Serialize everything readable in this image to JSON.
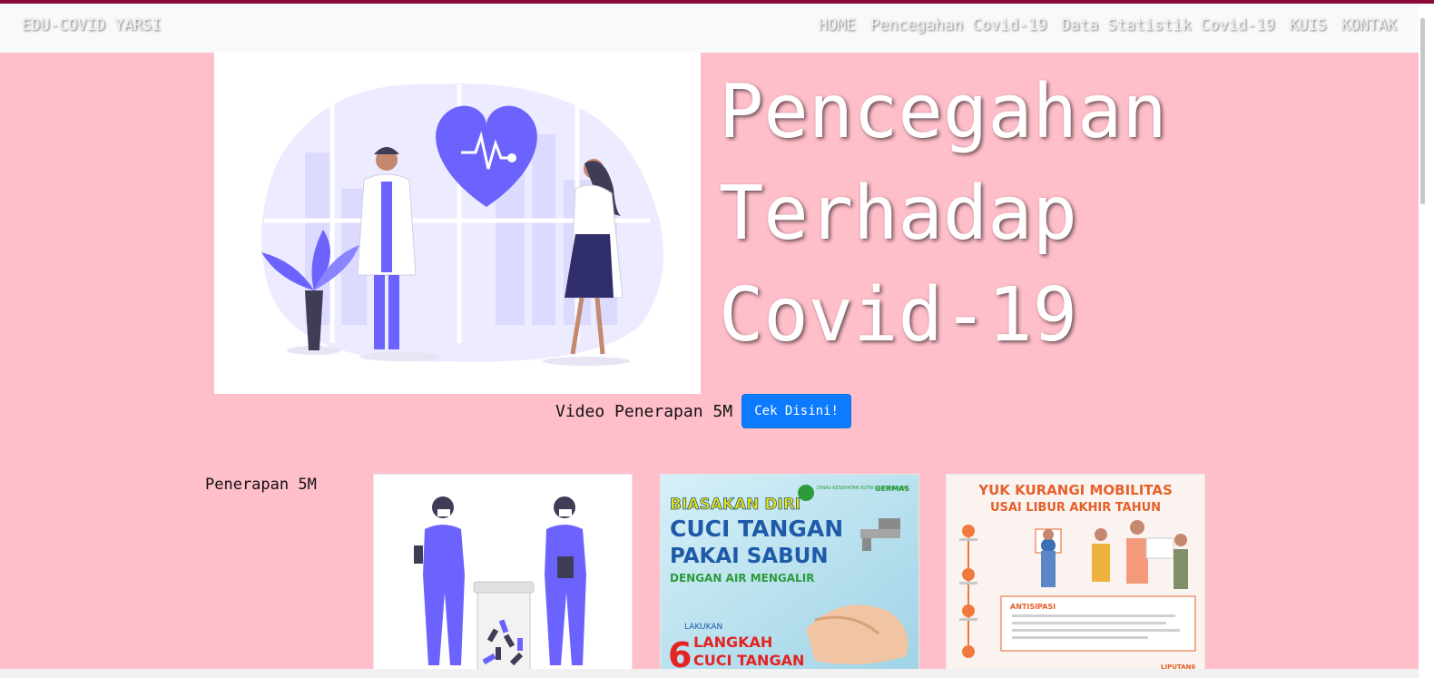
{
  "navbar": {
    "brand": "EDU-COVID YARSI",
    "links": [
      "HOME",
      "Pencegahan Covid-19",
      "Data Statistik Covid-19",
      "KUIS",
      "KONTAK"
    ]
  },
  "hero": {
    "title_lines": [
      "Pencegahan",
      "Terhadap",
      "Covid-19"
    ],
    "video_label": "Video Penerapan 5M",
    "cta_label": "Cek Disini!"
  },
  "section": {
    "label": "Penerapan 5M"
  },
  "cards": [
    {
      "alt": ""
    },
    {
      "lines": [
        "BIASAKAN DIRI",
        "CUCI TANGAN",
        "PAKAI SABUN",
        "DENGAN AIR MENGALIR",
        "LAKUKAN",
        "6",
        "LANGKAH",
        "CUCI TANGAN"
      ],
      "badges": [
        "DINAS KESEHATAN KUTAI KARTANEGARA",
        "GERMAS"
      ]
    },
    {
      "lines": [
        "YUK KURANGI MOBILITAS",
        "USAI LIBUR AKHIR TAHUN"
      ],
      "subheading": "ANTISIPASI",
      "footer": "LIPUTAN6"
    }
  ],
  "colors": {
    "hero_bg": "#ffbfca",
    "button": "#0d7bff",
    "illustration_accent": "#6c63ff",
    "topline": "#8b0a3a"
  }
}
